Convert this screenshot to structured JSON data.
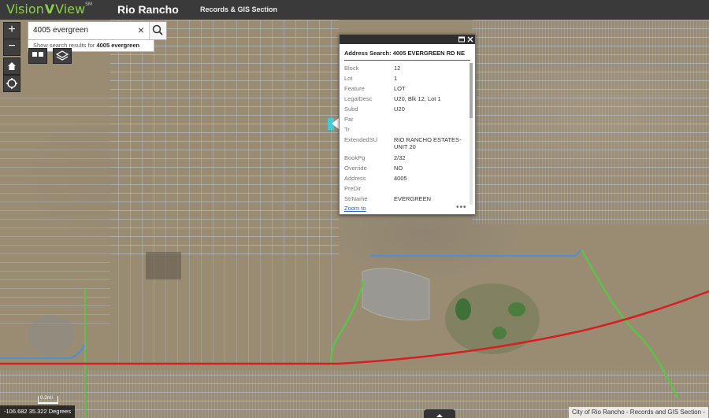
{
  "header": {
    "logo_left": "Vision",
    "logo_mid": "V",
    "logo_right": "View",
    "logo_tm": "SM",
    "app_title": "Rio Rancho",
    "section": "Records & GIS Section"
  },
  "map_controls": {
    "zoom_in": "+",
    "zoom_out": "−"
  },
  "search": {
    "value": "4005 evergreen",
    "clear": "×",
    "suggestion_prefix": "Show search results for ",
    "suggestion_term": "4005 evergreen"
  },
  "popup": {
    "title": "Address Search: 4005 EVERGREEN RD NE",
    "fields": [
      {
        "key": "Block",
        "value": "12"
      },
      {
        "key": "Lot",
        "value": "1"
      },
      {
        "key": "Feature",
        "value": "LOT"
      },
      {
        "key": "LegalDesc",
        "value": "U20, Blk 12, Lot 1"
      },
      {
        "key": "Subd",
        "value": "U20"
      },
      {
        "key": "Par",
        "value": ""
      },
      {
        "key": "Tr",
        "value": ""
      },
      {
        "key": "ExtendedSU",
        "value": "RIO RANCHO ESTATES-UNIT 20"
      },
      {
        "key": "BookPg",
        "value": "2/32"
      },
      {
        "key": "Override",
        "value": "NO"
      },
      {
        "key": "Address",
        "value": "4005"
      },
      {
        "key": "PreDir",
        "value": ""
      },
      {
        "key": "StrName",
        "value": "EVERGREEN"
      }
    ],
    "zoom_to": "Zoom to",
    "more": "•••"
  },
  "status": {
    "coordinates": "-106.682 35.322 Degrees",
    "scale_label": "0.2mi",
    "attribution": "City of Rio Rancho - Records and GIS Section -"
  },
  "colors": {
    "header_bg": "#3a3a3a",
    "logo_green": "#8ccf4d",
    "highway_red": "#d42020",
    "road_blue": "#4a8fd8",
    "road_green": "#5ec24a",
    "parcel_lines": "#b8c4d4"
  }
}
